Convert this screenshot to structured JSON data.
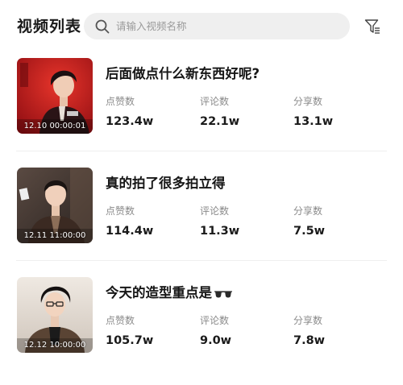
{
  "header": {
    "title": "视频列表",
    "search_placeholder": "请输入视频名称",
    "search_value": ""
  },
  "stat_labels": {
    "likes": "点赞数",
    "comments": "评论数",
    "shares": "分享数"
  },
  "videos": [
    {
      "title": "后面做点什么新东西好呢?",
      "time": "12.10 00:00:01",
      "likes": "123.4w",
      "comments": "22.1w",
      "shares": "13.1w"
    },
    {
      "title": "真的拍了很多拍立得",
      "time": "12.11 11:00:00",
      "likes": "114.4w",
      "comments": "11.3w",
      "shares": "7.5w"
    },
    {
      "title": "今天的造型重点是",
      "title_emoji": "glasses-emoji",
      "time": "12.12 10:00:00",
      "likes": "105.7w",
      "comments": "9.0w",
      "shares": "7.8w"
    }
  ],
  "icons": {
    "search": "search-icon",
    "filter": "filter-icon"
  },
  "colors": {
    "search_bg": "#efefef",
    "label_gray": "#8a8a8a",
    "thumb1_bg": "#c8151c",
    "thumb2_bg": "#3a3330",
    "thumb3_bg": "#e8e2dc"
  }
}
